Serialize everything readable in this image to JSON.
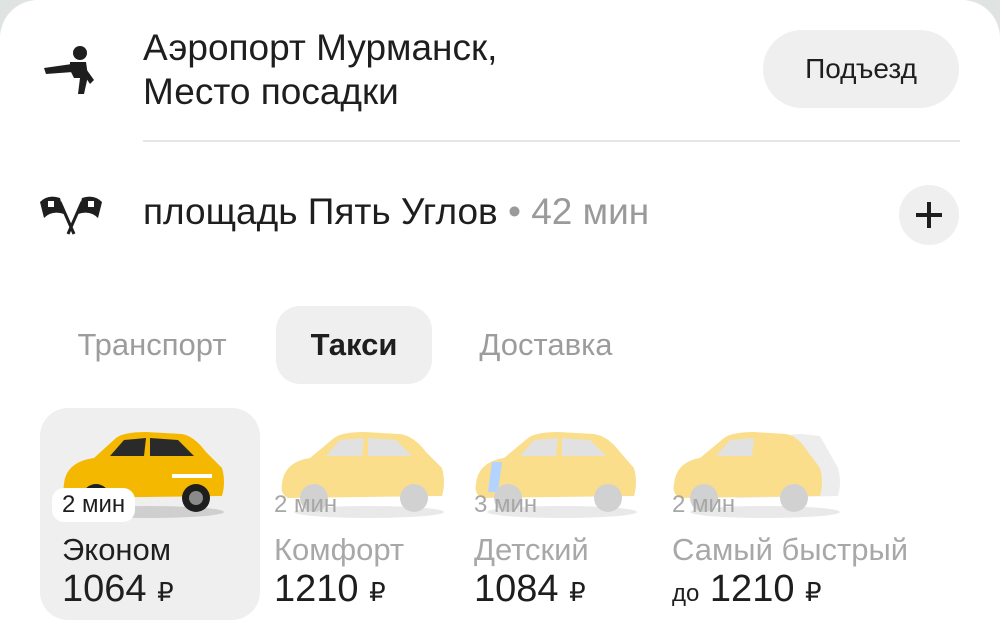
{
  "route": {
    "pickup": {
      "icon": "waving-person-icon",
      "title_line1": "Аэропорт Мурманск,",
      "title_line2": "Место посадки",
      "entrance_label": "Подъезд"
    },
    "destination": {
      "icon": "checkered-flags-icon",
      "name": "площадь Пять Углов",
      "separator": "•",
      "eta": "42 мин",
      "add_icon": "plus-icon"
    }
  },
  "tabs": [
    {
      "label": "Транспорт",
      "active": false
    },
    {
      "label": "Такси",
      "active": true
    },
    {
      "label": "Доставка",
      "active": false
    }
  ],
  "tariffs": [
    {
      "eta": "2 мин",
      "name": "Эконом",
      "price_prefix": "",
      "price": "1064",
      "currency": "₽",
      "selected": true
    },
    {
      "eta": "2 мин",
      "name": "Комфорт",
      "price_prefix": "",
      "price": "1210",
      "currency": "₽",
      "selected": false
    },
    {
      "eta": "3 мин",
      "name": "Детский",
      "price_prefix": "",
      "price": "1084",
      "currency": "₽",
      "selected": false
    },
    {
      "eta": "2 мин",
      "name": "Самый быстрый",
      "price_prefix": "до",
      "price": "1210",
      "currency": "₽",
      "selected": false
    }
  ],
  "colors": {
    "accent_yellow": "#f6c21c",
    "chip_gray": "#efefef",
    "muted_text": "#9c9c9c"
  }
}
